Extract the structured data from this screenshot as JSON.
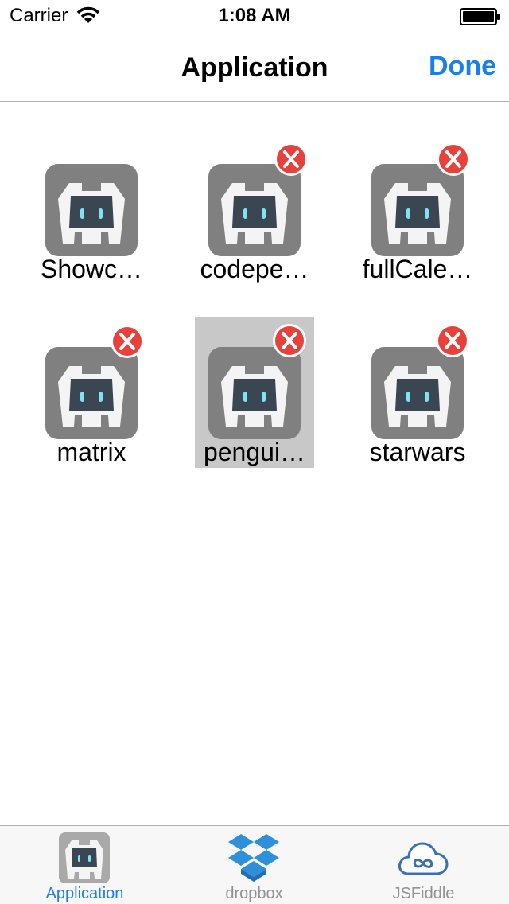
{
  "status_bar": {
    "carrier": "Carrier",
    "time": "1:08 AM",
    "icons": [
      "wifi-icon",
      "battery-icon"
    ]
  },
  "nav": {
    "title": "Application",
    "done_label": "Done"
  },
  "apps": [
    {
      "label": "Showc…",
      "icon": "cordova-icon",
      "deletable": false,
      "selected": false
    },
    {
      "label": "codepe…",
      "icon": "cordova-icon",
      "deletable": true,
      "selected": false
    },
    {
      "label": "fullCale…",
      "icon": "cordova-icon",
      "deletable": true,
      "selected": false
    },
    {
      "label": "matrix",
      "icon": "cordova-icon",
      "deletable": true,
      "selected": false
    },
    {
      "label": "pengui…",
      "icon": "cordova-icon",
      "deletable": true,
      "selected": true
    },
    {
      "label": "starwars",
      "icon": "cordova-icon",
      "deletable": true,
      "selected": false
    }
  ],
  "delete_badge": {
    "glyph": "X",
    "color": "#e8413c"
  },
  "tabs": [
    {
      "label": "Application",
      "icon": "cordova-icon",
      "active": true
    },
    {
      "label": "dropbox",
      "icon": "dropbox-icon",
      "active": false
    },
    {
      "label": "JSFiddle",
      "icon": "jsfiddle-cloud-icon",
      "active": false
    }
  ],
  "colors": {
    "accent": "#1a7fee",
    "inactive_tab": "#929292",
    "selection": "#c8c8c8"
  }
}
